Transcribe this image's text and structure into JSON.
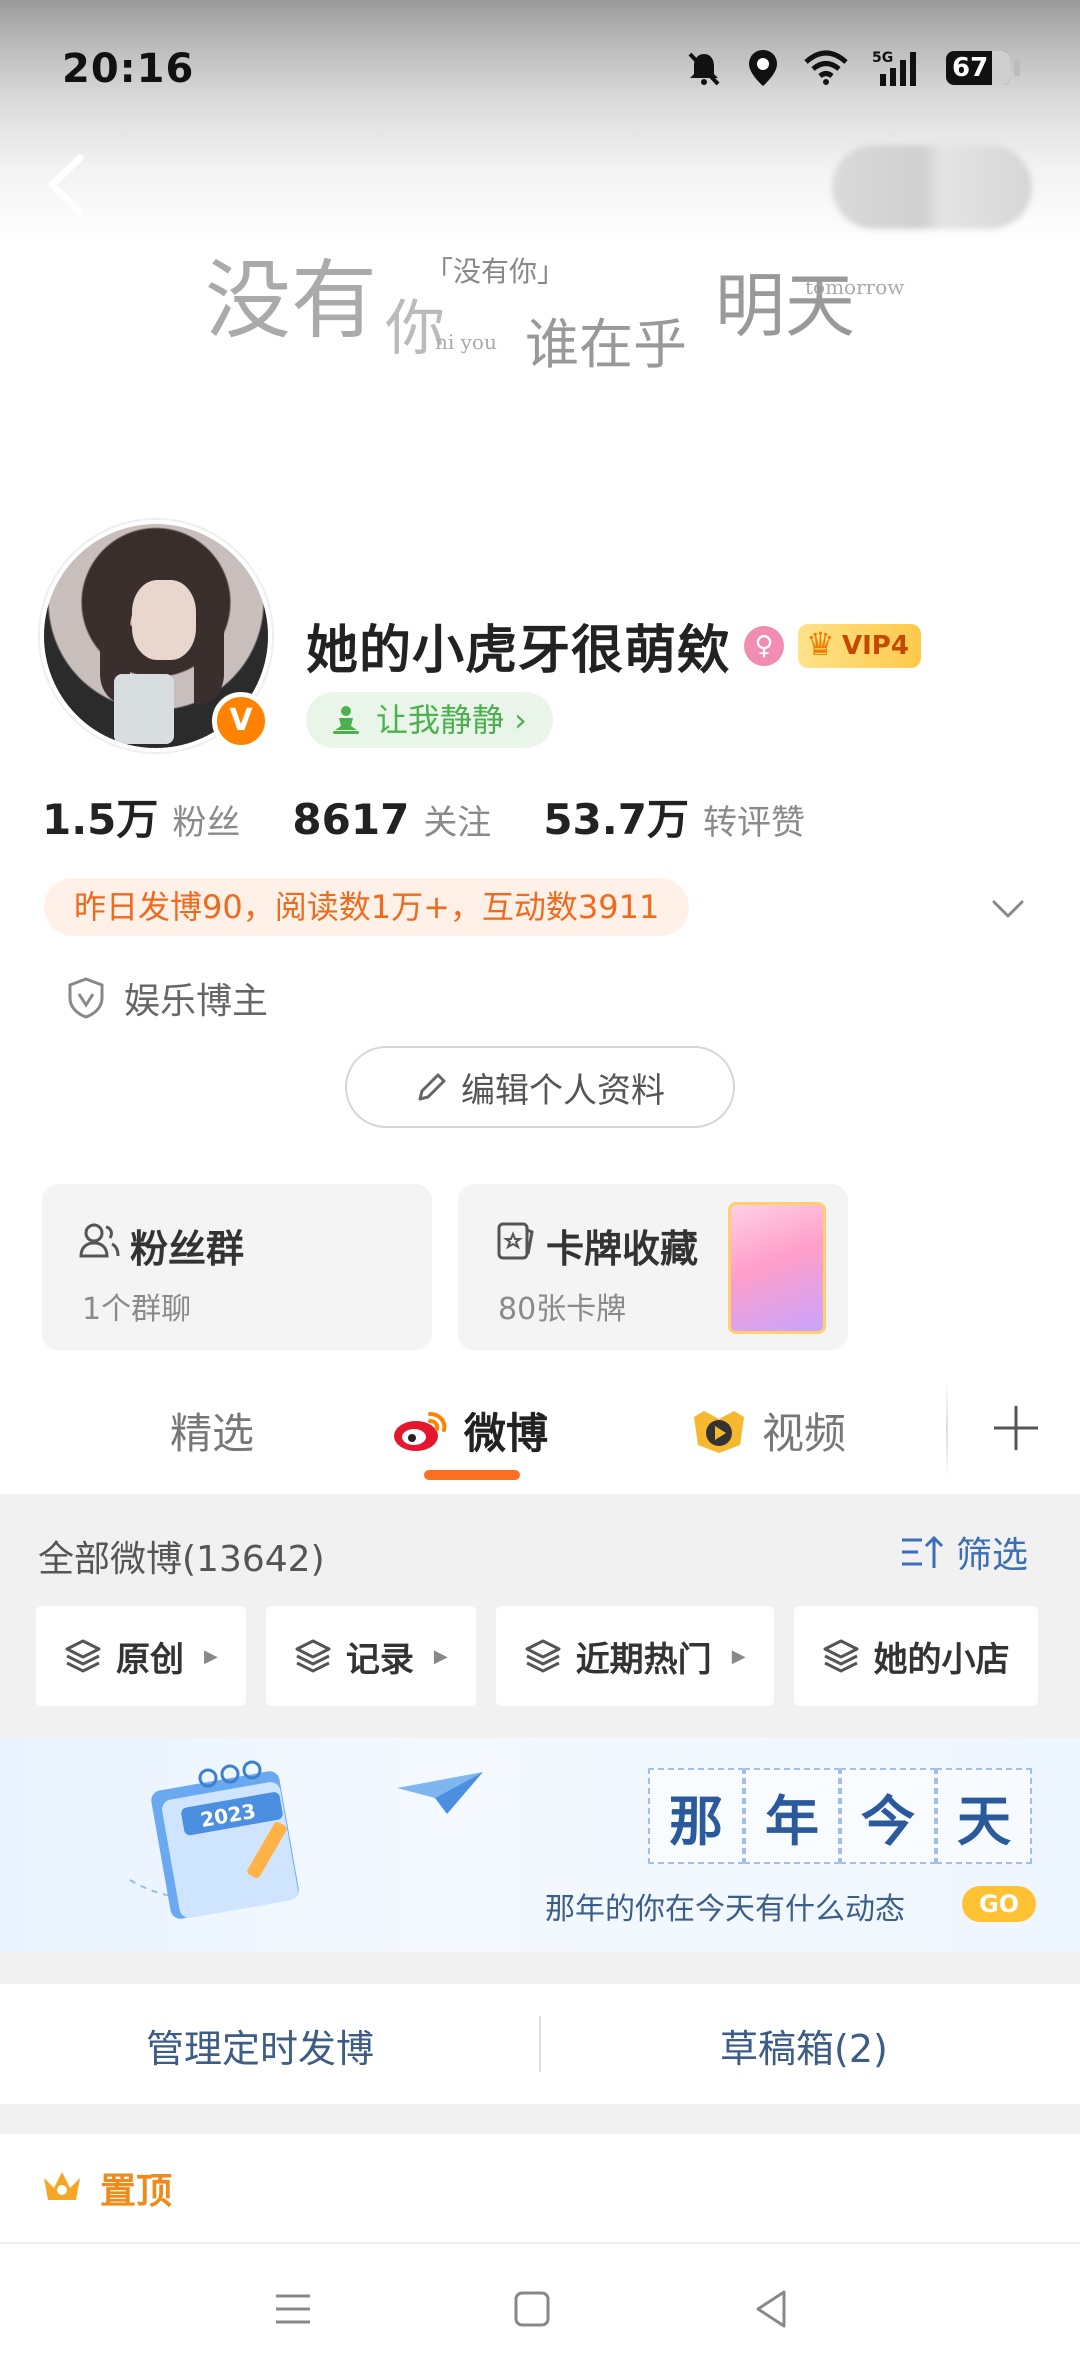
{
  "status_bar": {
    "time": "20:16",
    "battery": "67",
    "network": "5G"
  },
  "header": {
    "back_icon": "chevron-left-icon",
    "cover_texts": [
      "没有",
      "你",
      "「没有你」",
      "谁在乎",
      "明天",
      "tomorrow",
      "ni you"
    ]
  },
  "profile": {
    "nickname": "她的小虎牙很萌欸",
    "gender_icon": "female-icon",
    "vip_label": "VIP4",
    "verified_badge": "V",
    "mood": "让我静静 ›",
    "stats": [
      {
        "num": "1.5万",
        "label": "粉丝"
      },
      {
        "num": "8617",
        "label": "关注"
      },
      {
        "num": "53.7万",
        "label": "转评赞"
      }
    ],
    "activity": "昨日发博90，阅读数1万+，互动数3911",
    "cert": "娱乐博主",
    "edit_button": "编辑个人资料"
  },
  "cards": [
    {
      "title": "粉丝群",
      "sub": "1个群聊",
      "icon": "people-icon"
    },
    {
      "title": "卡牌收藏",
      "sub": "80张卡牌",
      "icon": "card-icon"
    }
  ],
  "tabs": [
    {
      "label": "精选",
      "active": false
    },
    {
      "label": "微博",
      "active": true
    },
    {
      "label": "视频",
      "active": false
    }
  ],
  "feed": {
    "header": "全部微博(13642)",
    "filter": "筛选",
    "chips": [
      "原创",
      "记录",
      "近期热门",
      "她的小店"
    ]
  },
  "promo": {
    "title_chars": [
      "那",
      "年",
      "今",
      "天"
    ],
    "subtitle": "那年的你在今天有什么动态",
    "go": "GO",
    "calendar_year": "2023"
  },
  "manage": {
    "left": "管理定时发博",
    "right": "草稿箱(2)"
  },
  "pinned": {
    "label": "置顶"
  },
  "colors": {
    "accent_orange": "#ff8200",
    "tab_underline": "#ff6e1f",
    "link_blue": "#3a6fb5",
    "mood_green": "#4caf50"
  }
}
